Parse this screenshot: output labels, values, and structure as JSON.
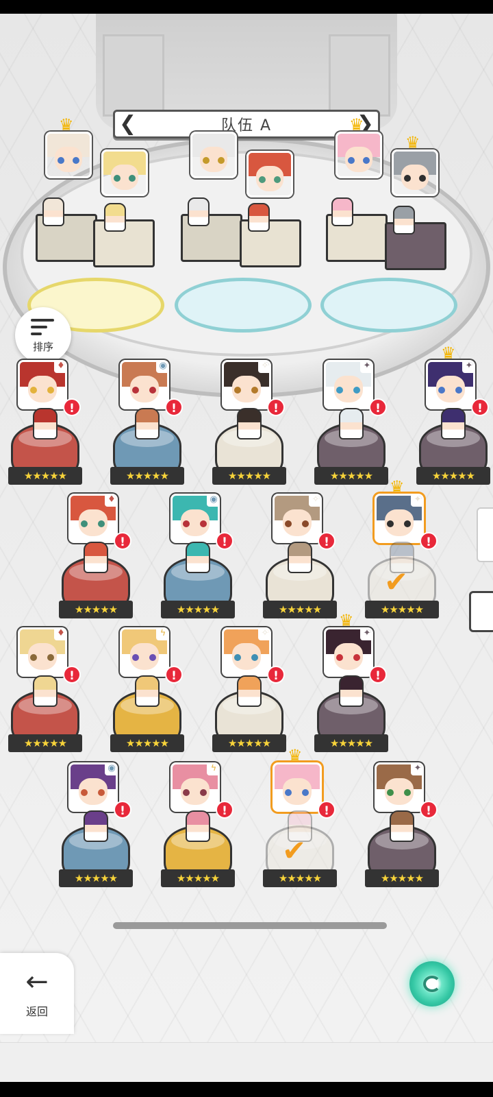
{
  "team": {
    "title": "队伍 A",
    "prev_label": "❮",
    "next_label": "❯"
  },
  "sort": {
    "label": "排序"
  },
  "back": {
    "label": "返回",
    "arrow": "←"
  },
  "icons": {
    "alert": "!",
    "stars": "★★★★★",
    "check": "✔",
    "crown": "♛"
  },
  "colors": {
    "fire": "#c4544a",
    "water": "#6f99b5",
    "light": "#e9e3d6",
    "dark": "#6f5f6a",
    "thunder": "#e5b444",
    "selected_outline": "#f29c1f",
    "alert": "#e8283a",
    "star": "#f7d33a"
  },
  "team_slots": [
    {
      "element": "light",
      "crown": true,
      "hair": "#f1e6d8",
      "eyes": "#4a78c8"
    },
    {
      "element": "light",
      "crown": false,
      "hair": "#f2dc8e",
      "eyes": "#3f8f7a"
    },
    {
      "element": "light",
      "crown": false,
      "hair": "#e9e9e9",
      "eyes": "#c49a2a"
    },
    {
      "element": "light",
      "crown": false,
      "hair": "#d8573f",
      "eyes": "#4f9a7d"
    },
    {
      "element": "light",
      "crown": true,
      "hair": "#f6b7c9",
      "eyes": "#4a78c8"
    },
    {
      "element": "dark",
      "crown": true,
      "hair": "#9aa0a6",
      "eyes": "#2f2f2f"
    }
  ],
  "roster": [
    {
      "element": "fire",
      "badge": "♦",
      "hair": "#b9352e",
      "eyes": "#e3b23c",
      "alert": true,
      "crown": false,
      "selected": false
    },
    {
      "element": "water",
      "badge": "◉",
      "hair": "#c97a52",
      "eyes": "#b8323a",
      "alert": true,
      "crown": false,
      "selected": false
    },
    {
      "element": "light",
      "badge": "✧",
      "hair": "#3a2f2a",
      "eyes": "#b37a2a",
      "alert": true,
      "crown": false,
      "selected": false
    },
    {
      "element": "dark",
      "badge": "✦",
      "hair": "#e6ecef",
      "eyes": "#3f9bc4",
      "alert": true,
      "crown": false,
      "selected": false
    },
    {
      "element": "dark",
      "badge": "✦",
      "hair": "#3e2f6f",
      "eyes": "#4a78c8",
      "alert": true,
      "crown": true,
      "selected": false
    },
    {
      "element": "fire",
      "badge": "♦",
      "hair": "#d8573f",
      "eyes": "#3f8f7a",
      "alert": true,
      "crown": false,
      "selected": false
    },
    {
      "element": "water",
      "badge": "◉",
      "hair": "#3cb7b0",
      "eyes": "#b8323a",
      "alert": true,
      "crown": false,
      "selected": false
    },
    {
      "element": "light",
      "badge": "✧",
      "hair": "#b39a80",
      "eyes": "#8a4a2a",
      "alert": true,
      "crown": false,
      "selected": false
    },
    {
      "element": "light",
      "badge": "✦",
      "hair": "#5a6f8a",
      "eyes": "#2f2f2f",
      "alert": true,
      "crown": true,
      "selected": true
    },
    {
      "element": "fire",
      "badge": "♦",
      "hair": "#efd692",
      "eyes": "#8a6a3a",
      "alert": true,
      "crown": false,
      "selected": false
    },
    {
      "element": "thunder",
      "badge": "ϟ",
      "hair": "#f0c878",
      "eyes": "#6a4fb4",
      "alert": true,
      "crown": false,
      "selected": false
    },
    {
      "element": "light",
      "badge": "✧",
      "hair": "#f0a25a",
      "eyes": "#3f8fb4",
      "alert": true,
      "crown": false,
      "selected": false
    },
    {
      "element": "dark",
      "badge": "✦",
      "hair": "#3a2430",
      "eyes": "#c8323a",
      "alert": true,
      "crown": true,
      "selected": false
    },
    {
      "element": "water",
      "badge": "◉",
      "hair": "#6a3f8a",
      "eyes": "#c85a3a",
      "alert": true,
      "crown": false,
      "selected": false
    },
    {
      "element": "thunder",
      "badge": "ϟ",
      "hair": "#e88fa2",
      "eyes": "#8a3a4a",
      "alert": true,
      "crown": false,
      "selected": false
    },
    {
      "element": "light",
      "badge": "",
      "hair": "#f6b7c9",
      "eyes": "#4a78c8",
      "alert": true,
      "crown": true,
      "selected": true
    },
    {
      "element": "dark",
      "badge": "✦",
      "hair": "#9a6a48",
      "eyes": "#3f8f4a",
      "alert": true,
      "crown": false,
      "selected": false
    }
  ]
}
